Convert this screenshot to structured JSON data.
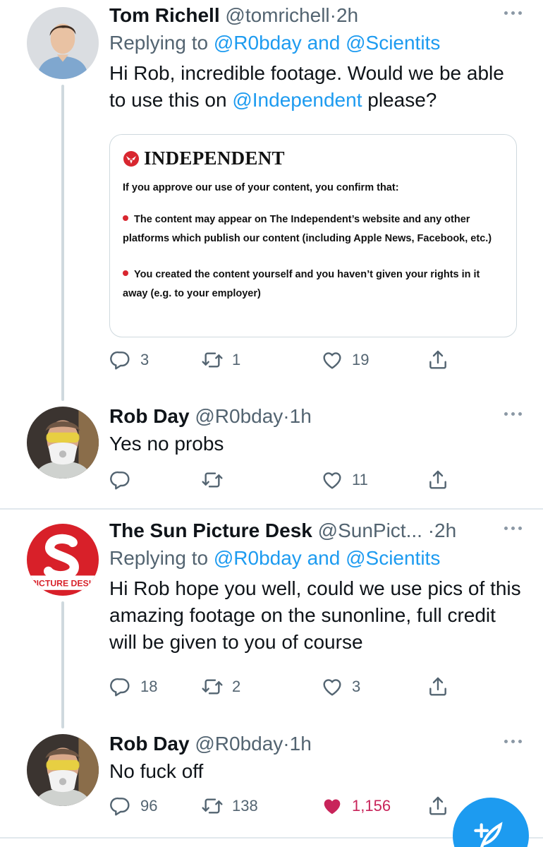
{
  "tweets": [
    {
      "name": "Tom Richell",
      "handle": "@tomrichell",
      "dot": "·",
      "time": "2h",
      "replying_prefix": "Replying to ",
      "replying_user1": "@R0bday",
      "replying_and": " and ",
      "replying_user2": "@Scientits",
      "text_before": "Hi Rob, incredible footage. Would we be able to use this on ",
      "text_mention": "@Independent",
      "text_after": " please?",
      "reply_count": "3",
      "retweet_count": "1",
      "like_count": "19"
    },
    {
      "name": "Rob Day",
      "handle": "@R0bday",
      "dot": "·",
      "time": "1h",
      "text": "Yes no probs",
      "reply_count": "",
      "retweet_count": "",
      "like_count": "11"
    },
    {
      "name": "The Sun Picture Desk",
      "handle": "@SunPict...",
      "dot": "·",
      "time": "2h",
      "replying_prefix": "Replying to ",
      "replying_user1": "@R0bday",
      "replying_and": " and ",
      "replying_user2": "@Scientits",
      "text": "Hi Rob hope you well, could we use pics of this amazing footage on the sunonline, full credit will be given to you of course",
      "reply_count": "18",
      "retweet_count": "2",
      "like_count": "3",
      "avatar_text": "PICTURE DESK"
    },
    {
      "name": "Rob Day",
      "handle": "@R0bday",
      "dot": "·",
      "time": "1h",
      "text": "No fuck off",
      "reply_count": "96",
      "retweet_count": "138",
      "like_count": "1,156"
    }
  ],
  "card": {
    "logo": "INDEPENDENT",
    "heading": "If you approve our use of your content, you confirm that:",
    "bullet1_line1": "The content may appear on The Independent’s website and any other",
    "bullet1_line2": "platforms which publish our content (including Apple News, Facebook, etc.)",
    "bullet2_line1": "You created the content yourself and you haven’t given your rights in it",
    "bullet2_line2": "away (e.g. to your employer)"
  },
  "colors": {
    "link": "#1d9bf0",
    "liked": "#c8245a",
    "secondary_text": "#536471",
    "sun_red": "#d82029"
  },
  "icons": {
    "reply": "reply-icon",
    "retweet": "retweet-icon",
    "like": "heart-icon",
    "share": "share-icon",
    "more": "more-icon",
    "compose": "compose-icon"
  }
}
